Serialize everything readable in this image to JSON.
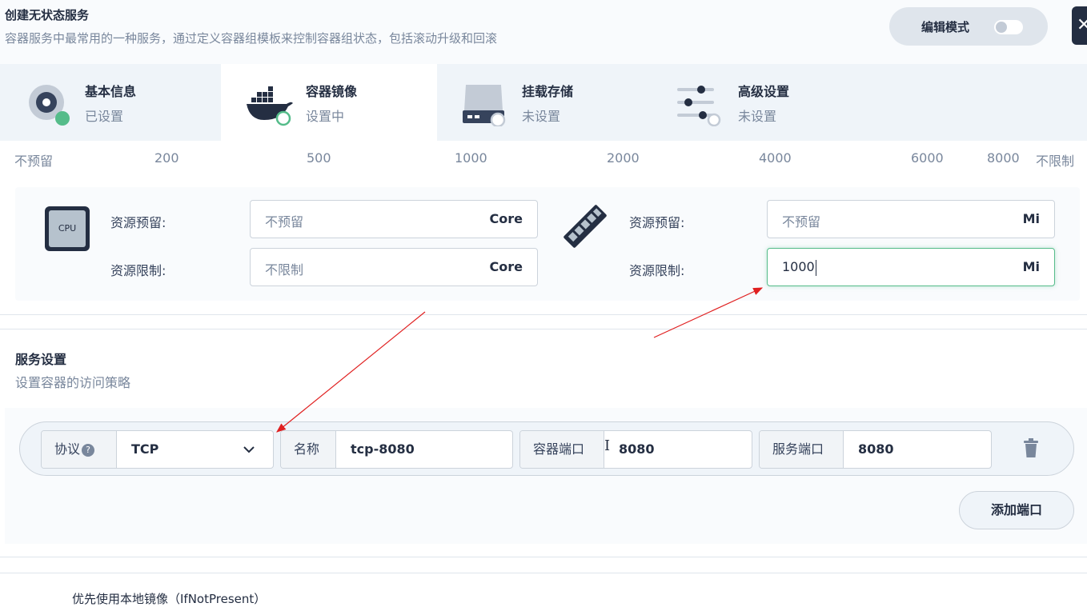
{
  "header": {
    "title": "创建无状态服务",
    "subtitle": "容器服务中最常用的一种服务，通过定义容器组模板来控制容器组状态，包括滚动升级和回滚",
    "edit_mode_label": "编辑模式",
    "close_glyph": "✕"
  },
  "steps": [
    {
      "name": "基本信息",
      "status": "已设置",
      "icon": "disc-icon"
    },
    {
      "name": "容器镜像",
      "status": "设置中",
      "icon": "docker-whale-icon"
    },
    {
      "name": "挂载存储",
      "status": "未设置",
      "icon": "storage-drive-icon"
    },
    {
      "name": "高级设置",
      "status": "未设置",
      "icon": "sliders-icon"
    }
  ],
  "memory_ticks": [
    "不预留",
    "200",
    "500",
    "1000",
    "2000",
    "4000",
    "6000",
    "8000",
    "不限制"
  ],
  "resources": {
    "cpu_icon_text": "CPU",
    "cpu": {
      "request_label": "资源预留:",
      "request_value": "不预留",
      "limit_label": "资源限制:",
      "limit_value": "不限制",
      "unit": "Core"
    },
    "memory": {
      "request_label": "资源预留:",
      "request_value": "不预留",
      "limit_label": "资源限制:",
      "limit_value": "1000",
      "unit": "Mi"
    }
  },
  "service": {
    "title": "服务设置",
    "subtitle": "设置容器的访问策略",
    "port": {
      "protocol_label": "协议",
      "help_glyph": "?",
      "protocol_value": "TCP",
      "name_label": "名称",
      "name_value": "tcp-8080",
      "container_port_label": "容器端口",
      "container_port_value": "8080",
      "service_port_label": "服务端口",
      "service_port_value": "8080"
    },
    "add_port_label": "添加端口"
  },
  "bottom_text": "优先使用本地镜像（IfNotPresent）",
  "colors": {
    "accent_green": "#55bc8a",
    "dark": "#242e42",
    "annotation_red": "#e02020"
  }
}
